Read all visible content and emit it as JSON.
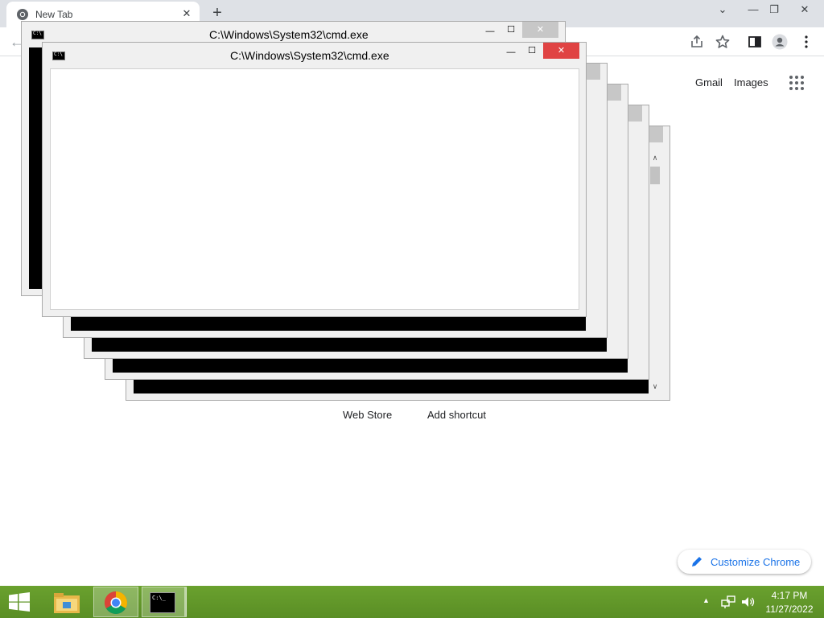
{
  "browser": {
    "tab_title": "New Tab",
    "tab_close": "✕",
    "new_tab": "+",
    "minimize": "—",
    "restore": "❐",
    "close": "✕",
    "back": "←",
    "header_links": [
      "Gmail",
      "Images"
    ],
    "shortcuts": [
      "Web Store",
      "Add shortcut"
    ],
    "customize_label": "Customize Chrome"
  },
  "cmd_windows": {
    "title": "C:\\Windows\\System32\\cmd.exe",
    "minimize": "—",
    "maximize": "☐",
    "close": "✕",
    "scroll_up": "∧",
    "scroll_down": "∨"
  },
  "taskbar": {
    "items": [
      "start",
      "file-explorer",
      "chrome",
      "cmd"
    ],
    "time": "4:17 PM",
    "date": "11/27/2022",
    "tray_chevron": "▲"
  },
  "colors": {
    "taskbar": "#5f9828",
    "close_active": "#e04343",
    "link_blue": "#1a73e8"
  }
}
